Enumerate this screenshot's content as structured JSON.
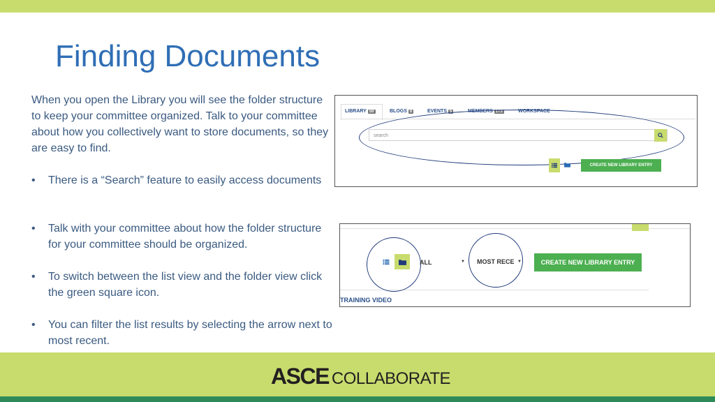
{
  "slide": {
    "title": "Finding Documents",
    "intro": "When you open the Library you will see the folder structure to keep your committee organized. Talk to your committee about how you collectively want to store documents, so they are easy to find.",
    "bullet_char": "•",
    "bullets": [
      "There is a “Search” feature to easily access documents",
      "Talk with your committee about how the folder structure for your committee should be organized.",
      "To switch between the list view and the folder view click the green square icon.",
      "You can filter the list results by selecting the arrow next to most recent."
    ]
  },
  "screenshot1": {
    "tabs": [
      {
        "label": "LIBRARY",
        "count": "50"
      },
      {
        "label": "BLOGS",
        "count": "0"
      },
      {
        "label": "EVENTS",
        "count": "5"
      },
      {
        "label": "MEMBERS",
        "count": "173"
      },
      {
        "label": "WORKSPACE",
        "count": ""
      }
    ],
    "search_placeholder": "search",
    "search_icon": "search-icon",
    "create_button": "CREATE NEW LIBRARY ENTRY"
  },
  "screenshot2": {
    "filter_all": "ALL",
    "sort_label": "MOST RECE",
    "create_button": "CREATE NEW LIBRARY ENTRY",
    "training_link": "TRAINING VIDEO"
  },
  "footer": {
    "logo_bold": "ASCE",
    "logo_light": "COLLABORATE"
  },
  "colors": {
    "accent_green": "#c8dc6e",
    "button_green": "#4caf50",
    "title_blue": "#2f6eb5",
    "text_blue": "#3a5a80"
  }
}
